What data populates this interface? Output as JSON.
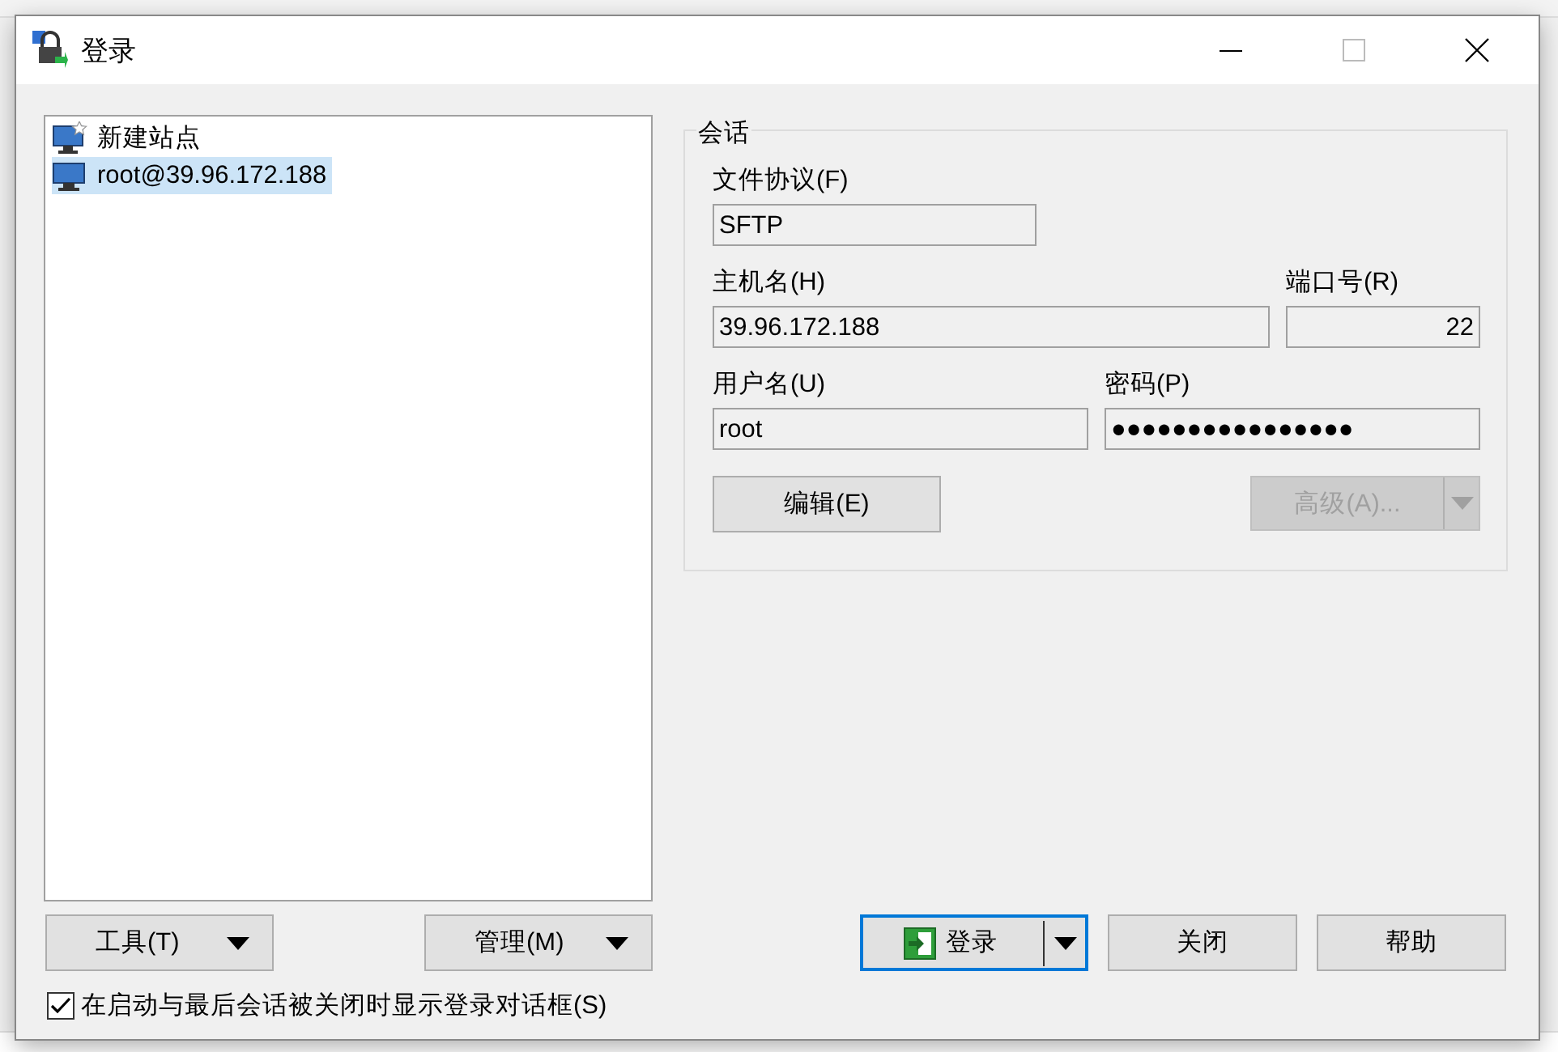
{
  "window": {
    "title": "登录"
  },
  "sites": [
    {
      "label": "新建站点",
      "kind": "new",
      "selected": false
    },
    {
      "label": "root@39.96.172.188",
      "kind": "saved",
      "selected": true
    }
  ],
  "session": {
    "title": "会话",
    "protocol": {
      "label": "文件协议(F)",
      "value": "SFTP"
    },
    "host": {
      "label": "主机名(H)",
      "value": "39.96.172.188"
    },
    "port": {
      "label": "端口号(R)",
      "value": "22"
    },
    "user": {
      "label": "用户名(U)",
      "value": "root"
    },
    "password": {
      "label": "密码(P)",
      "value": "●●●●●●●●●●●●●●●●"
    },
    "edit_button": {
      "label": "编辑(E)",
      "disabled": false
    },
    "advanced_button": {
      "label": "高级(A)...",
      "disabled": true
    }
  },
  "left_buttons": [
    {
      "label": "工具(T)"
    },
    {
      "label": "管理(M)"
    }
  ],
  "actions": [
    {
      "label": "登录",
      "kind": "split",
      "default": true
    },
    {
      "label": "关闭",
      "kind": "plain",
      "default": false
    },
    {
      "label": "帮助",
      "kind": "plain",
      "default": false
    }
  ],
  "show_on_startup": {
    "label": "在启动与最后会话被关闭时显示登录对话框(S)",
    "checked": true
  }
}
